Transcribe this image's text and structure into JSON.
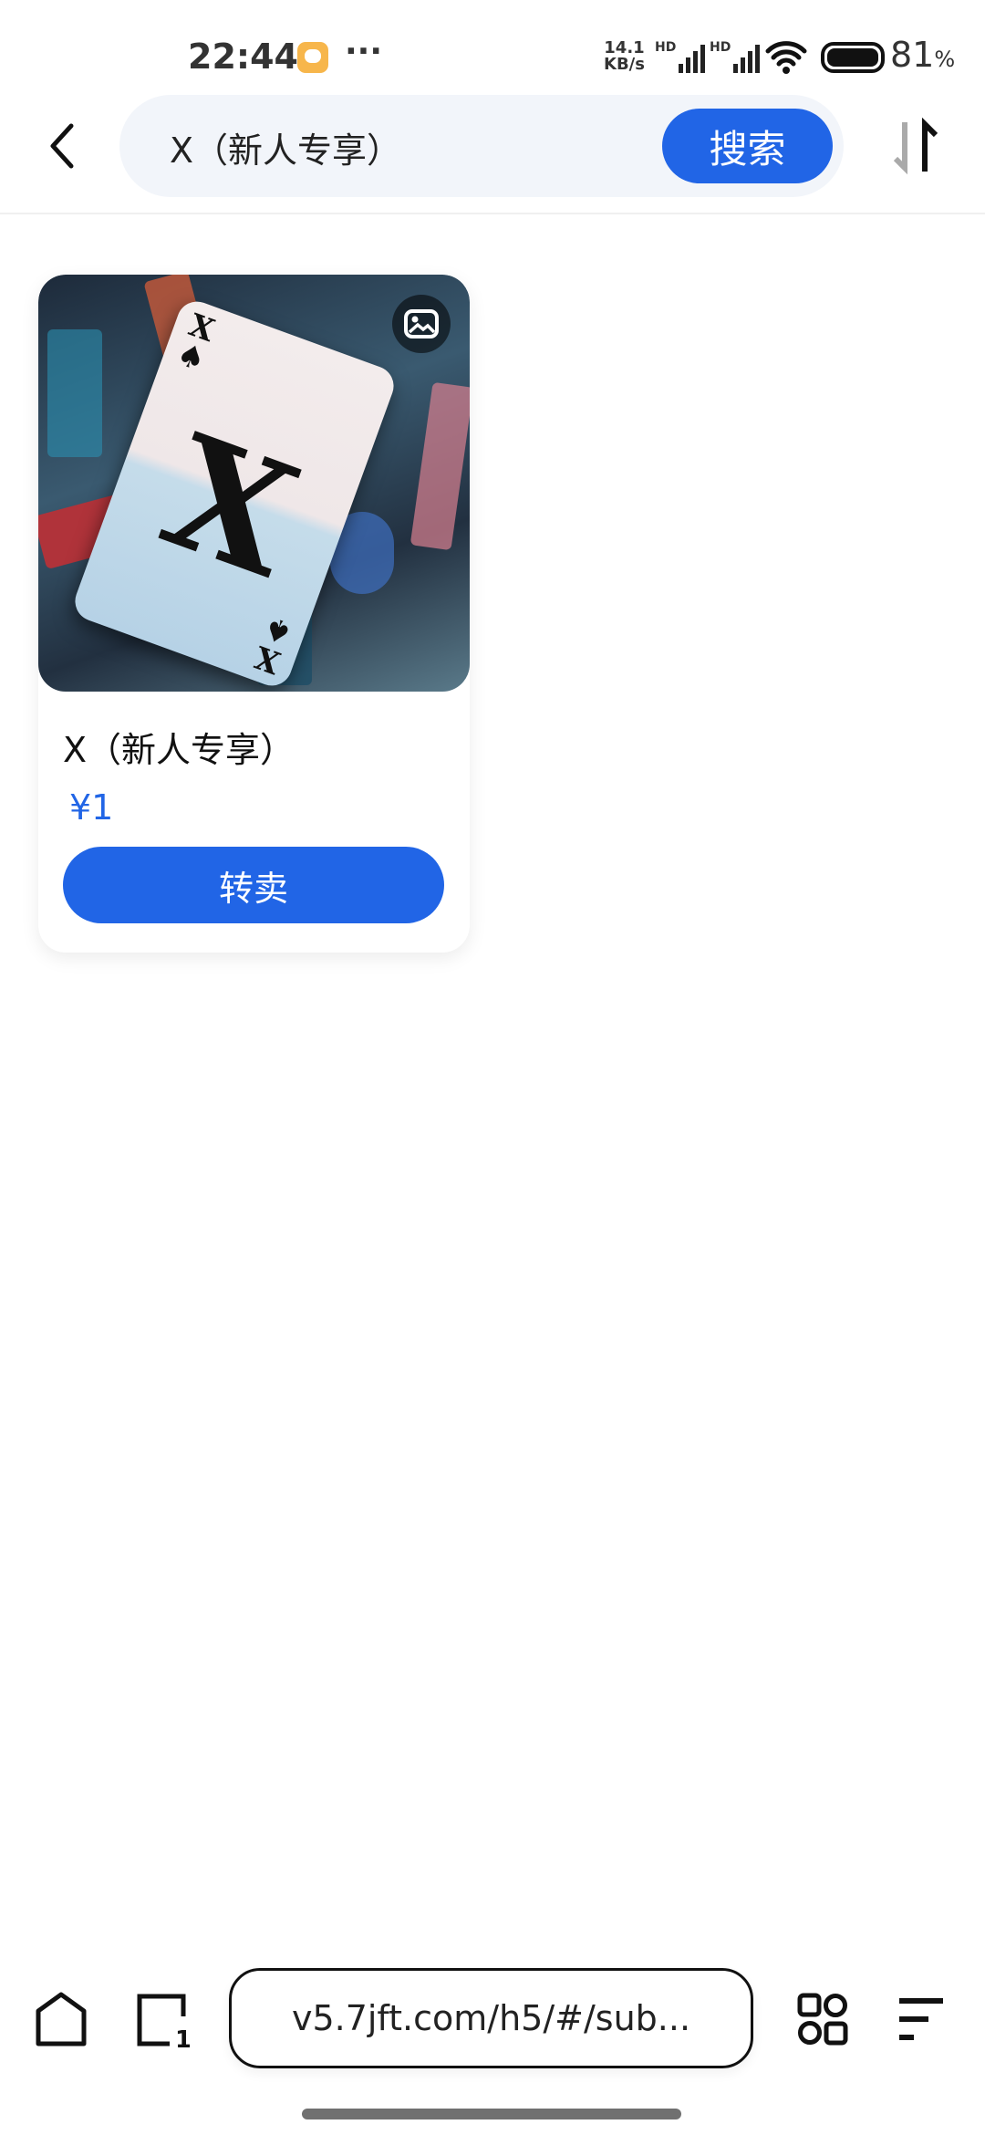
{
  "status_bar": {
    "time": "22:44",
    "net_speed_value": "14.1",
    "net_speed_unit": "KB/s",
    "sim1": "HD",
    "sim2": "HD",
    "battery": "81",
    "battery_unit": "%",
    "more": "···"
  },
  "header": {
    "search_value": "X（新人专享）",
    "search_button": "搜索"
  },
  "products": [
    {
      "title": "X（新人专享）",
      "price": "¥1",
      "action": "转卖",
      "card_rank": "X"
    }
  ],
  "browser": {
    "url": "v5.7jft.com/h5/#/sub..."
  },
  "colors": {
    "accent": "#2165e6",
    "search_bg": "#f2f5fa",
    "notification": "#f7b64b"
  }
}
